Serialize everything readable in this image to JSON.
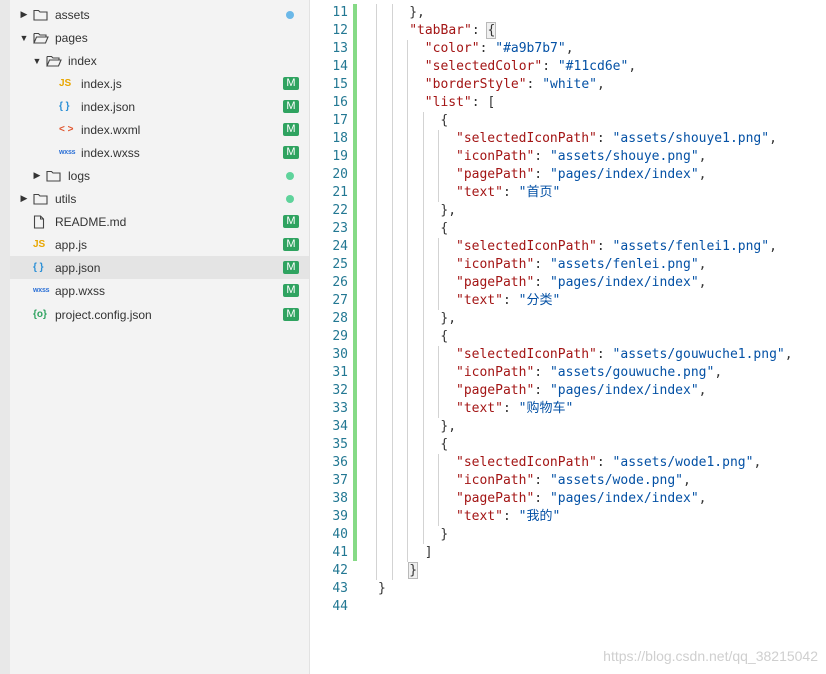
{
  "explorer": {
    "items": [
      {
        "label": "assets",
        "type": "folder",
        "expanded": false,
        "depth": 0,
        "status": "dot",
        "status_color": "#6bb8e8"
      },
      {
        "label": "pages",
        "type": "folder",
        "expanded": true,
        "depth": 0,
        "status": "",
        "status_color": ""
      },
      {
        "label": "index",
        "type": "folder",
        "expanded": true,
        "depth": 1,
        "status": "",
        "status_color": ""
      },
      {
        "label": "index.js",
        "type": "js",
        "depth": 2,
        "status": "M",
        "status_color": "#2fa360"
      },
      {
        "label": "index.json",
        "type": "json",
        "depth": 2,
        "status": "M",
        "status_color": "#2fa360"
      },
      {
        "label": "index.wxml",
        "type": "wxml",
        "depth": 2,
        "status": "M",
        "status_color": "#2fa360"
      },
      {
        "label": "index.wxss",
        "type": "wxss",
        "depth": 2,
        "status": "M",
        "status_color": "#2fa360"
      },
      {
        "label": "logs",
        "type": "folder",
        "expanded": false,
        "depth": 1,
        "status": "dot",
        "status_color": "#5fd39b"
      },
      {
        "label": "utils",
        "type": "folder",
        "expanded": false,
        "depth": 0,
        "status": "dot",
        "status_color": "#5fd39b"
      },
      {
        "label": "README.md",
        "type": "file",
        "depth": 0,
        "status": "M",
        "status_color": "#2fa360"
      },
      {
        "label": "app.js",
        "type": "js",
        "depth": 0,
        "status": "M",
        "status_color": "#2fa360"
      },
      {
        "label": "app.json",
        "type": "json",
        "depth": 0,
        "status": "M",
        "status_color": "#2fa360",
        "selected": true
      },
      {
        "label": "app.wxss",
        "type": "wxss",
        "depth": 0,
        "status": "M",
        "status_color": "#2fa360"
      },
      {
        "label": "project.config.json",
        "type": "config",
        "depth": 0,
        "status": "M",
        "status_color": "#2fa360"
      }
    ],
    "icon_labels": {
      "js": "JS",
      "json": "{ }",
      "wxml": "< >",
      "wxss": "wxss",
      "config": "{o}"
    },
    "icon_colors": {
      "js": "#e8a600",
      "json": "#2a8fd6",
      "wxml": "#e0542c",
      "wxss": "#2a6fd6",
      "config": "#2fa360"
    }
  },
  "editor": {
    "lines": [
      {
        "n": "11",
        "indent": 2,
        "tokens": [
          [
            "p",
            "},"
          ]
        ]
      },
      {
        "n": "12",
        "indent": 2,
        "tokens": [
          [
            "k",
            "\"tabBar\""
          ],
          [
            "p",
            ": "
          ],
          [
            "hl",
            "{"
          ]
        ]
      },
      {
        "n": "13",
        "indent": 3,
        "tokens": [
          [
            "k",
            "\"color\""
          ],
          [
            "p",
            ": "
          ],
          [
            "s",
            "\"#a9b7b7\""
          ],
          [
            "p",
            ","
          ]
        ]
      },
      {
        "n": "14",
        "indent": 3,
        "tokens": [
          [
            "k",
            "\"selectedColor\""
          ],
          [
            "p",
            ": "
          ],
          [
            "s",
            "\"#11cd6e\""
          ],
          [
            "p",
            ","
          ]
        ]
      },
      {
        "n": "15",
        "indent": 3,
        "tokens": [
          [
            "k",
            "\"borderStyle\""
          ],
          [
            "p",
            ": "
          ],
          [
            "s",
            "\"white\""
          ],
          [
            "p",
            ","
          ]
        ]
      },
      {
        "n": "16",
        "indent": 3,
        "tokens": [
          [
            "k",
            "\"list\""
          ],
          [
            "p",
            ": ["
          ]
        ]
      },
      {
        "n": "17",
        "indent": 4,
        "tokens": [
          [
            "p",
            "{"
          ]
        ]
      },
      {
        "n": "18",
        "indent": 5,
        "tokens": [
          [
            "k",
            "\"selectedIconPath\""
          ],
          [
            "p",
            ": "
          ],
          [
            "s",
            "\"assets/shouye1.png\""
          ],
          [
            "p",
            ","
          ]
        ]
      },
      {
        "n": "19",
        "indent": 5,
        "tokens": [
          [
            "k",
            "\"iconPath\""
          ],
          [
            "p",
            ": "
          ],
          [
            "s",
            "\"assets/shouye.png\""
          ],
          [
            "p",
            ","
          ]
        ]
      },
      {
        "n": "20",
        "indent": 5,
        "tokens": [
          [
            "k",
            "\"pagePath\""
          ],
          [
            "p",
            ": "
          ],
          [
            "s",
            "\"pages/index/index\""
          ],
          [
            "p",
            ","
          ]
        ]
      },
      {
        "n": "21",
        "indent": 5,
        "tokens": [
          [
            "k",
            "\"text\""
          ],
          [
            "p",
            ": "
          ],
          [
            "s",
            "\"首页\""
          ]
        ]
      },
      {
        "n": "22",
        "indent": 4,
        "tokens": [
          [
            "p",
            "},"
          ]
        ]
      },
      {
        "n": "23",
        "indent": 4,
        "tokens": [
          [
            "p",
            "{"
          ]
        ]
      },
      {
        "n": "24",
        "indent": 5,
        "tokens": [
          [
            "k",
            "\"selectedIconPath\""
          ],
          [
            "p",
            ": "
          ],
          [
            "s",
            "\"assets/fenlei1.png\""
          ],
          [
            "p",
            ","
          ]
        ]
      },
      {
        "n": "25",
        "indent": 5,
        "tokens": [
          [
            "k",
            "\"iconPath\""
          ],
          [
            "p",
            ": "
          ],
          [
            "s",
            "\"assets/fenlei.png\""
          ],
          [
            "p",
            ","
          ]
        ]
      },
      {
        "n": "26",
        "indent": 5,
        "tokens": [
          [
            "k",
            "\"pagePath\""
          ],
          [
            "p",
            ": "
          ],
          [
            "s",
            "\"pages/index/index\""
          ],
          [
            "p",
            ","
          ]
        ]
      },
      {
        "n": "27",
        "indent": 5,
        "tokens": [
          [
            "k",
            "\"text\""
          ],
          [
            "p",
            ": "
          ],
          [
            "s",
            "\"分类\""
          ]
        ]
      },
      {
        "n": "28",
        "indent": 4,
        "tokens": [
          [
            "p",
            "},"
          ]
        ]
      },
      {
        "n": "29",
        "indent": 4,
        "tokens": [
          [
            "p",
            "{"
          ]
        ]
      },
      {
        "n": "30",
        "indent": 5,
        "tokens": [
          [
            "k",
            "\"selectedIconPath\""
          ],
          [
            "p",
            ": "
          ],
          [
            "s",
            "\"assets/gouwuche1.png\""
          ],
          [
            "p",
            ","
          ]
        ]
      },
      {
        "n": "31",
        "indent": 5,
        "tokens": [
          [
            "k",
            "\"iconPath\""
          ],
          [
            "p",
            ": "
          ],
          [
            "s",
            "\"assets/gouwuche.png\""
          ],
          [
            "p",
            ","
          ]
        ]
      },
      {
        "n": "32",
        "indent": 5,
        "tokens": [
          [
            "k",
            "\"pagePath\""
          ],
          [
            "p",
            ": "
          ],
          [
            "s",
            "\"pages/index/index\""
          ],
          [
            "p",
            ","
          ]
        ]
      },
      {
        "n": "33",
        "indent": 5,
        "tokens": [
          [
            "k",
            "\"text\""
          ],
          [
            "p",
            ": "
          ],
          [
            "s",
            "\"购物车\""
          ]
        ]
      },
      {
        "n": "34",
        "indent": 4,
        "tokens": [
          [
            "p",
            "},"
          ]
        ]
      },
      {
        "n": "35",
        "indent": 4,
        "tokens": [
          [
            "p",
            "{"
          ]
        ]
      },
      {
        "n": "36",
        "indent": 5,
        "tokens": [
          [
            "k",
            "\"selectedIconPath\""
          ],
          [
            "p",
            ": "
          ],
          [
            "s",
            "\"assets/wode1.png\""
          ],
          [
            "p",
            ","
          ]
        ]
      },
      {
        "n": "37",
        "indent": 5,
        "tokens": [
          [
            "k",
            "\"iconPath\""
          ],
          [
            "p",
            ": "
          ],
          [
            "s",
            "\"assets/wode.png\""
          ],
          [
            "p",
            ","
          ]
        ]
      },
      {
        "n": "38",
        "indent": 5,
        "tokens": [
          [
            "k",
            "\"pagePath\""
          ],
          [
            "p",
            ": "
          ],
          [
            "s",
            "\"pages/index/index\""
          ],
          [
            "p",
            ","
          ]
        ]
      },
      {
        "n": "39",
        "indent": 5,
        "tokens": [
          [
            "k",
            "\"text\""
          ],
          [
            "p",
            ": "
          ],
          [
            "s",
            "\"我的\""
          ]
        ]
      },
      {
        "n": "40",
        "indent": 4,
        "tokens": [
          [
            "p",
            "}"
          ]
        ]
      },
      {
        "n": "41",
        "indent": 3,
        "tokens": [
          [
            "p",
            "]"
          ]
        ]
      },
      {
        "n": "42",
        "indent": 2,
        "tokens": [
          [
            "hl",
            "}"
          ]
        ]
      },
      {
        "n": "43",
        "indent": 0,
        "tokens": [
          [
            "p",
            "}"
          ]
        ]
      },
      {
        "n": "44",
        "indent": 0,
        "tokens": []
      }
    ]
  },
  "watermark": "https://blog.csdn.net/qq_38215042"
}
